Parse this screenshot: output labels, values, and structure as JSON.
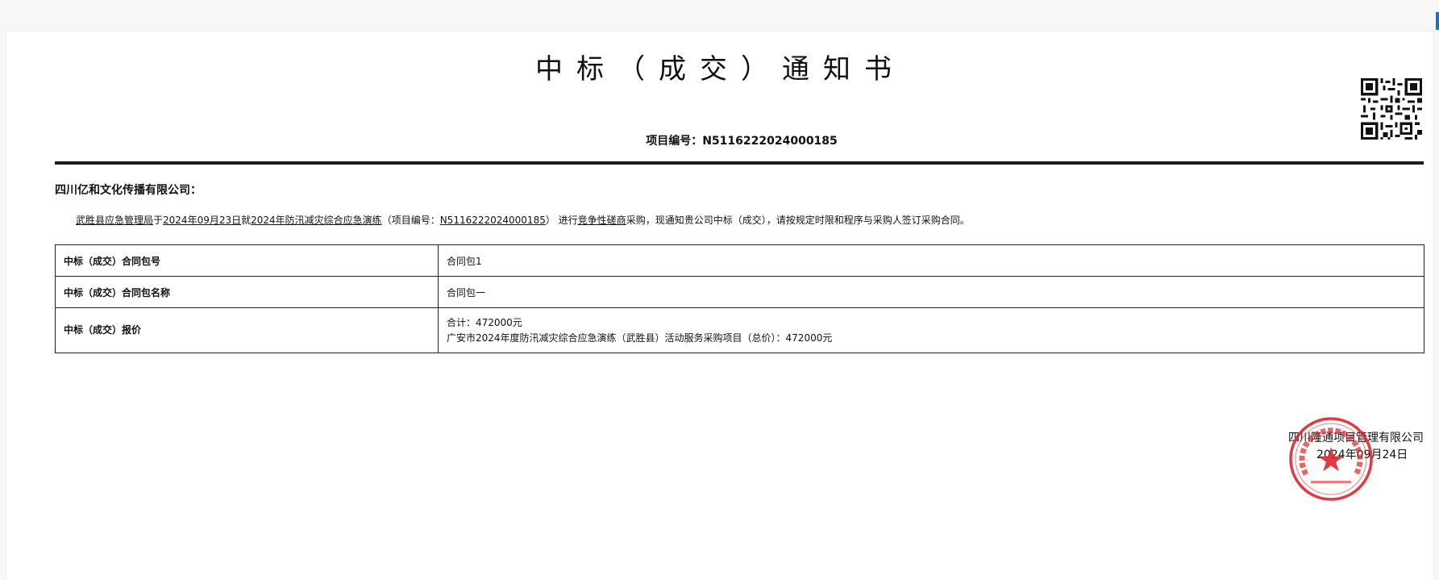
{
  "document": {
    "title": "中标（成交）通知书",
    "project_number_line": "项目编号：N5116222024000185",
    "addressee": "四川亿和文化传播有限公司：",
    "body": {
      "purchaser": "武胜县应急管理局",
      "preposition": "于",
      "date": "2024年09月23日",
      "conjunction": "就",
      "project_name": "2024年防汛减灾综合应急演练",
      "project_no_prefix": "（项目编号：",
      "project_no": "N5116222024000185",
      "project_no_suffix": "）  进行",
      "method": "竞争性磋商",
      "rest": "采购，现通知贵公司中标（成交），请按规定时限和程序与采购人签订采购合同。"
    },
    "table": {
      "rows": [
        {
          "label": "中标（成交）合同包号",
          "value_lines": [
            "合同包1"
          ]
        },
        {
          "label": "中标（成交）合同包名称",
          "value_lines": [
            "合同包一"
          ]
        },
        {
          "label": "中标（成交）报价",
          "value_lines": [
            "合计：472000元",
            "广安市2024年度防汛减灾综合应急演练（武胜县）活动服务采购项目（总价）：472000元"
          ]
        }
      ]
    },
    "signature": {
      "agency": "四川隆通项目管理有限公司",
      "date": "2024年09月24日"
    },
    "seal": {
      "color": "#e0242b"
    }
  }
}
